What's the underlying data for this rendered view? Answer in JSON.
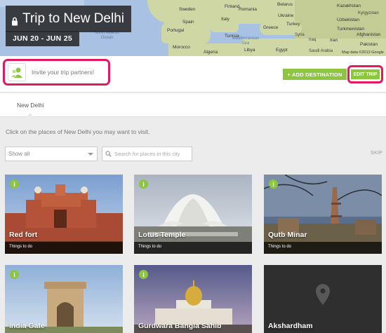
{
  "header": {
    "title": "Trip to New Delhi",
    "dates": "JUN 20 - JUN 25"
  },
  "map": {
    "labels": [
      "Sweden",
      "Finland",
      "Belarus",
      "Ukraine",
      "Romania",
      "Kazakhstan",
      "Spain",
      "Italy",
      "Greece",
      "Turkey",
      "Uzbekistan",
      "Turkmenistan",
      "Portugal",
      "Morocco",
      "Algeria",
      "Tunisia",
      "Syria",
      "Iraq",
      "Iran",
      "Afghanistan",
      "Pakistan",
      "Libya",
      "Egypt",
      "Saudi Arabia",
      "North Atlantic Ocean",
      "Mediterranean Sea",
      "Kyrgyzstan"
    ],
    "copyright": "Map data ©2013 Google"
  },
  "toolbar": {
    "invite_label": "Invite your trip partners!",
    "add_destination_label": "+ ADD DESTINATION",
    "edit_trip_label": "EDIT TRIP"
  },
  "tabs": [
    {
      "label": "New Delhi",
      "active": true
    }
  ],
  "instructions": "Click on the places of New Delhi you may want to visit.",
  "filters": {
    "select_value": "Show all",
    "search_placeholder": "Search for places in this city",
    "skip_label": "SKIP"
  },
  "places": [
    {
      "name": "Red fort",
      "category": "Things to do",
      "info_icon": "i"
    },
    {
      "name": "Lotus Temple",
      "category": "Things to do",
      "info_icon": "i"
    },
    {
      "name": "Qutb Minar",
      "category": "Things to do",
      "info_icon": "i"
    },
    {
      "name": "India Gate",
      "category": "",
      "info_icon": "i"
    },
    {
      "name": "Gurdwara Bangla Sahib",
      "category": "",
      "info_icon": "i"
    },
    {
      "name": "Akshardham",
      "category": "",
      "info_icon": ""
    }
  ],
  "colors": {
    "accent_green": "#8cc63e",
    "highlight_pink": "#e2195f",
    "title_bg": "#282828"
  }
}
